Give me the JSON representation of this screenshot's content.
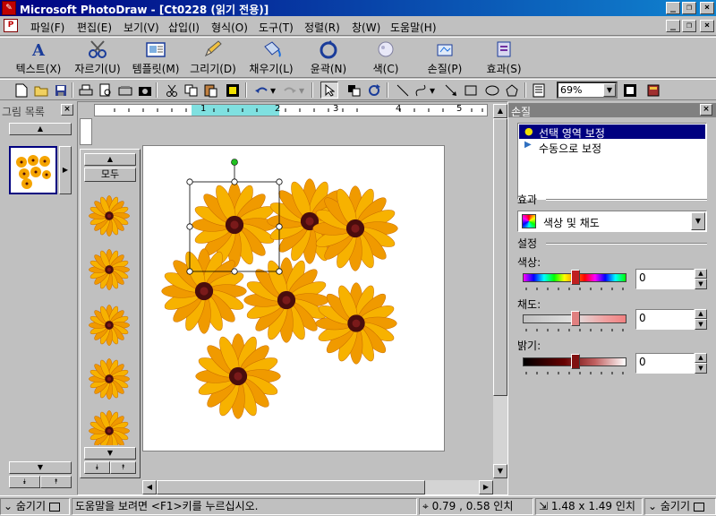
{
  "window": {
    "title": "Microsoft PhotoDraw - [Ct0228 (읽기 전용)]",
    "icon": "photodraw-app-icon",
    "controls": [
      "_",
      "❐",
      "×"
    ]
  },
  "menu": {
    "items": [
      "파일(F)",
      "편집(E)",
      "보기(V)",
      "삽입(I)",
      "형식(O)",
      "도구(T)",
      "정렬(R)",
      "창(W)",
      "도움말(H)"
    ]
  },
  "visual_toolbar": {
    "buttons": [
      "텍스트(X)",
      "자르기(U)",
      "템플릿(M)",
      "그리기(D)",
      "채우기(L)",
      "윤곽(N)",
      "색(C)",
      "손질(P)",
      "효과(S)"
    ]
  },
  "standard_toolbar": {
    "zoom": "69%"
  },
  "picture_list": {
    "title": "그림 목록"
  },
  "gallery": {
    "all_label": "모두"
  },
  "touchup_panel": {
    "title": "손질",
    "options": [
      "선택 영역 보정",
      "수동으로 보정"
    ],
    "selected_index": 0,
    "effect_label": "효과",
    "effect_value": "색상 및 채도",
    "settings_label": "설정",
    "sliders": [
      {
        "label": "색상:",
        "value": "0"
      },
      {
        "label": "채도:",
        "value": "0"
      },
      {
        "label": "밝기:",
        "value": "0"
      }
    ]
  },
  "status": {
    "hide_left": "숨기기",
    "help": "도움말을 보려면 <F1>키를 누르십시오.",
    "position": "0.79 , 0.58 인치",
    "size": "1.48 x 1.49 인치",
    "hide_right": "숨기기"
  },
  "ruler": {
    "labels": [
      "1",
      "2",
      "3",
      "4",
      "5"
    ]
  }
}
